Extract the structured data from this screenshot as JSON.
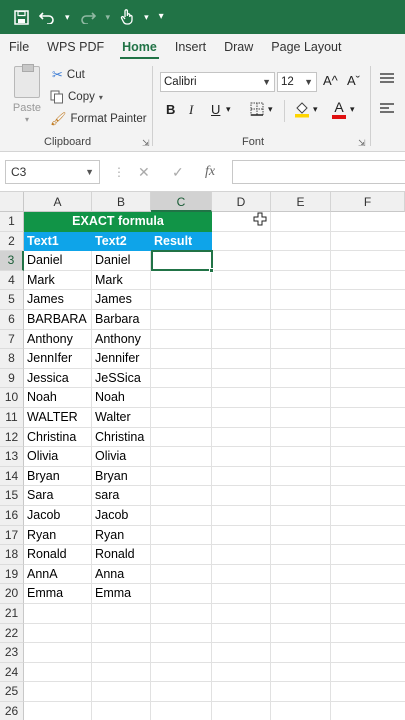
{
  "menu": {
    "tabs": [
      "File",
      "WPS PDF",
      "Home",
      "Insert",
      "Draw",
      "Page Layout"
    ],
    "active": "Home"
  },
  "ribbon": {
    "clipboard": {
      "paste": "Paste",
      "cut": "Cut",
      "copy": "Copy",
      "format_painter": "Format Painter",
      "label": "Clipboard"
    },
    "font": {
      "name": "Calibri",
      "size": "12",
      "grow": "A^",
      "shrink": "Aˇ",
      "bold": "B",
      "italic": "I",
      "underline": "U",
      "color_letter": "A",
      "label": "Font"
    }
  },
  "formula_bar": {
    "name_box": "C3",
    "fx": "fx",
    "cancel": "✕",
    "enter": "✓",
    "value": ""
  },
  "sheet": {
    "columns": [
      "A",
      "B",
      "C",
      "D",
      "E",
      "F"
    ],
    "selected_column": "C",
    "selected_row": 3,
    "rows": [
      "1",
      "2",
      "3",
      "4",
      "5",
      "6",
      "7",
      "8",
      "9",
      "10",
      "11",
      "12",
      "13",
      "14",
      "15",
      "16",
      "17",
      "18",
      "19",
      "20",
      "21",
      "22",
      "23",
      "24",
      "25",
      "26"
    ],
    "title": "EXACT formula",
    "headers": {
      "a": "Text1",
      "b": "Text2",
      "c": "Result"
    },
    "data": [
      [
        "Daniel",
        "Daniel"
      ],
      [
        "Mark",
        "Mark"
      ],
      [
        "James",
        "James"
      ],
      [
        "BARBARA",
        "Barbara"
      ],
      [
        "Anthony",
        "Anthony"
      ],
      [
        "JennIfer",
        "Jennifer"
      ],
      [
        "Jessica",
        "JeSSica"
      ],
      [
        "Noah",
        "Noah"
      ],
      [
        "WALTER",
        "Walter"
      ],
      [
        "Christina",
        "Christina"
      ],
      [
        "Olivia",
        "Olivia"
      ],
      [
        "Bryan",
        "Bryan"
      ],
      [
        "Sara",
        "sara"
      ],
      [
        "Jacob",
        "Jacob"
      ],
      [
        "Ryan",
        "Ryan"
      ],
      [
        "Ronald",
        "Ronald"
      ],
      [
        "AnnA",
        "Anna"
      ],
      [
        "Emma",
        "Emma"
      ]
    ]
  },
  "colors": {
    "brand": "#217346",
    "title_fill": "#119447",
    "header_fill": "#0ea4e9"
  }
}
